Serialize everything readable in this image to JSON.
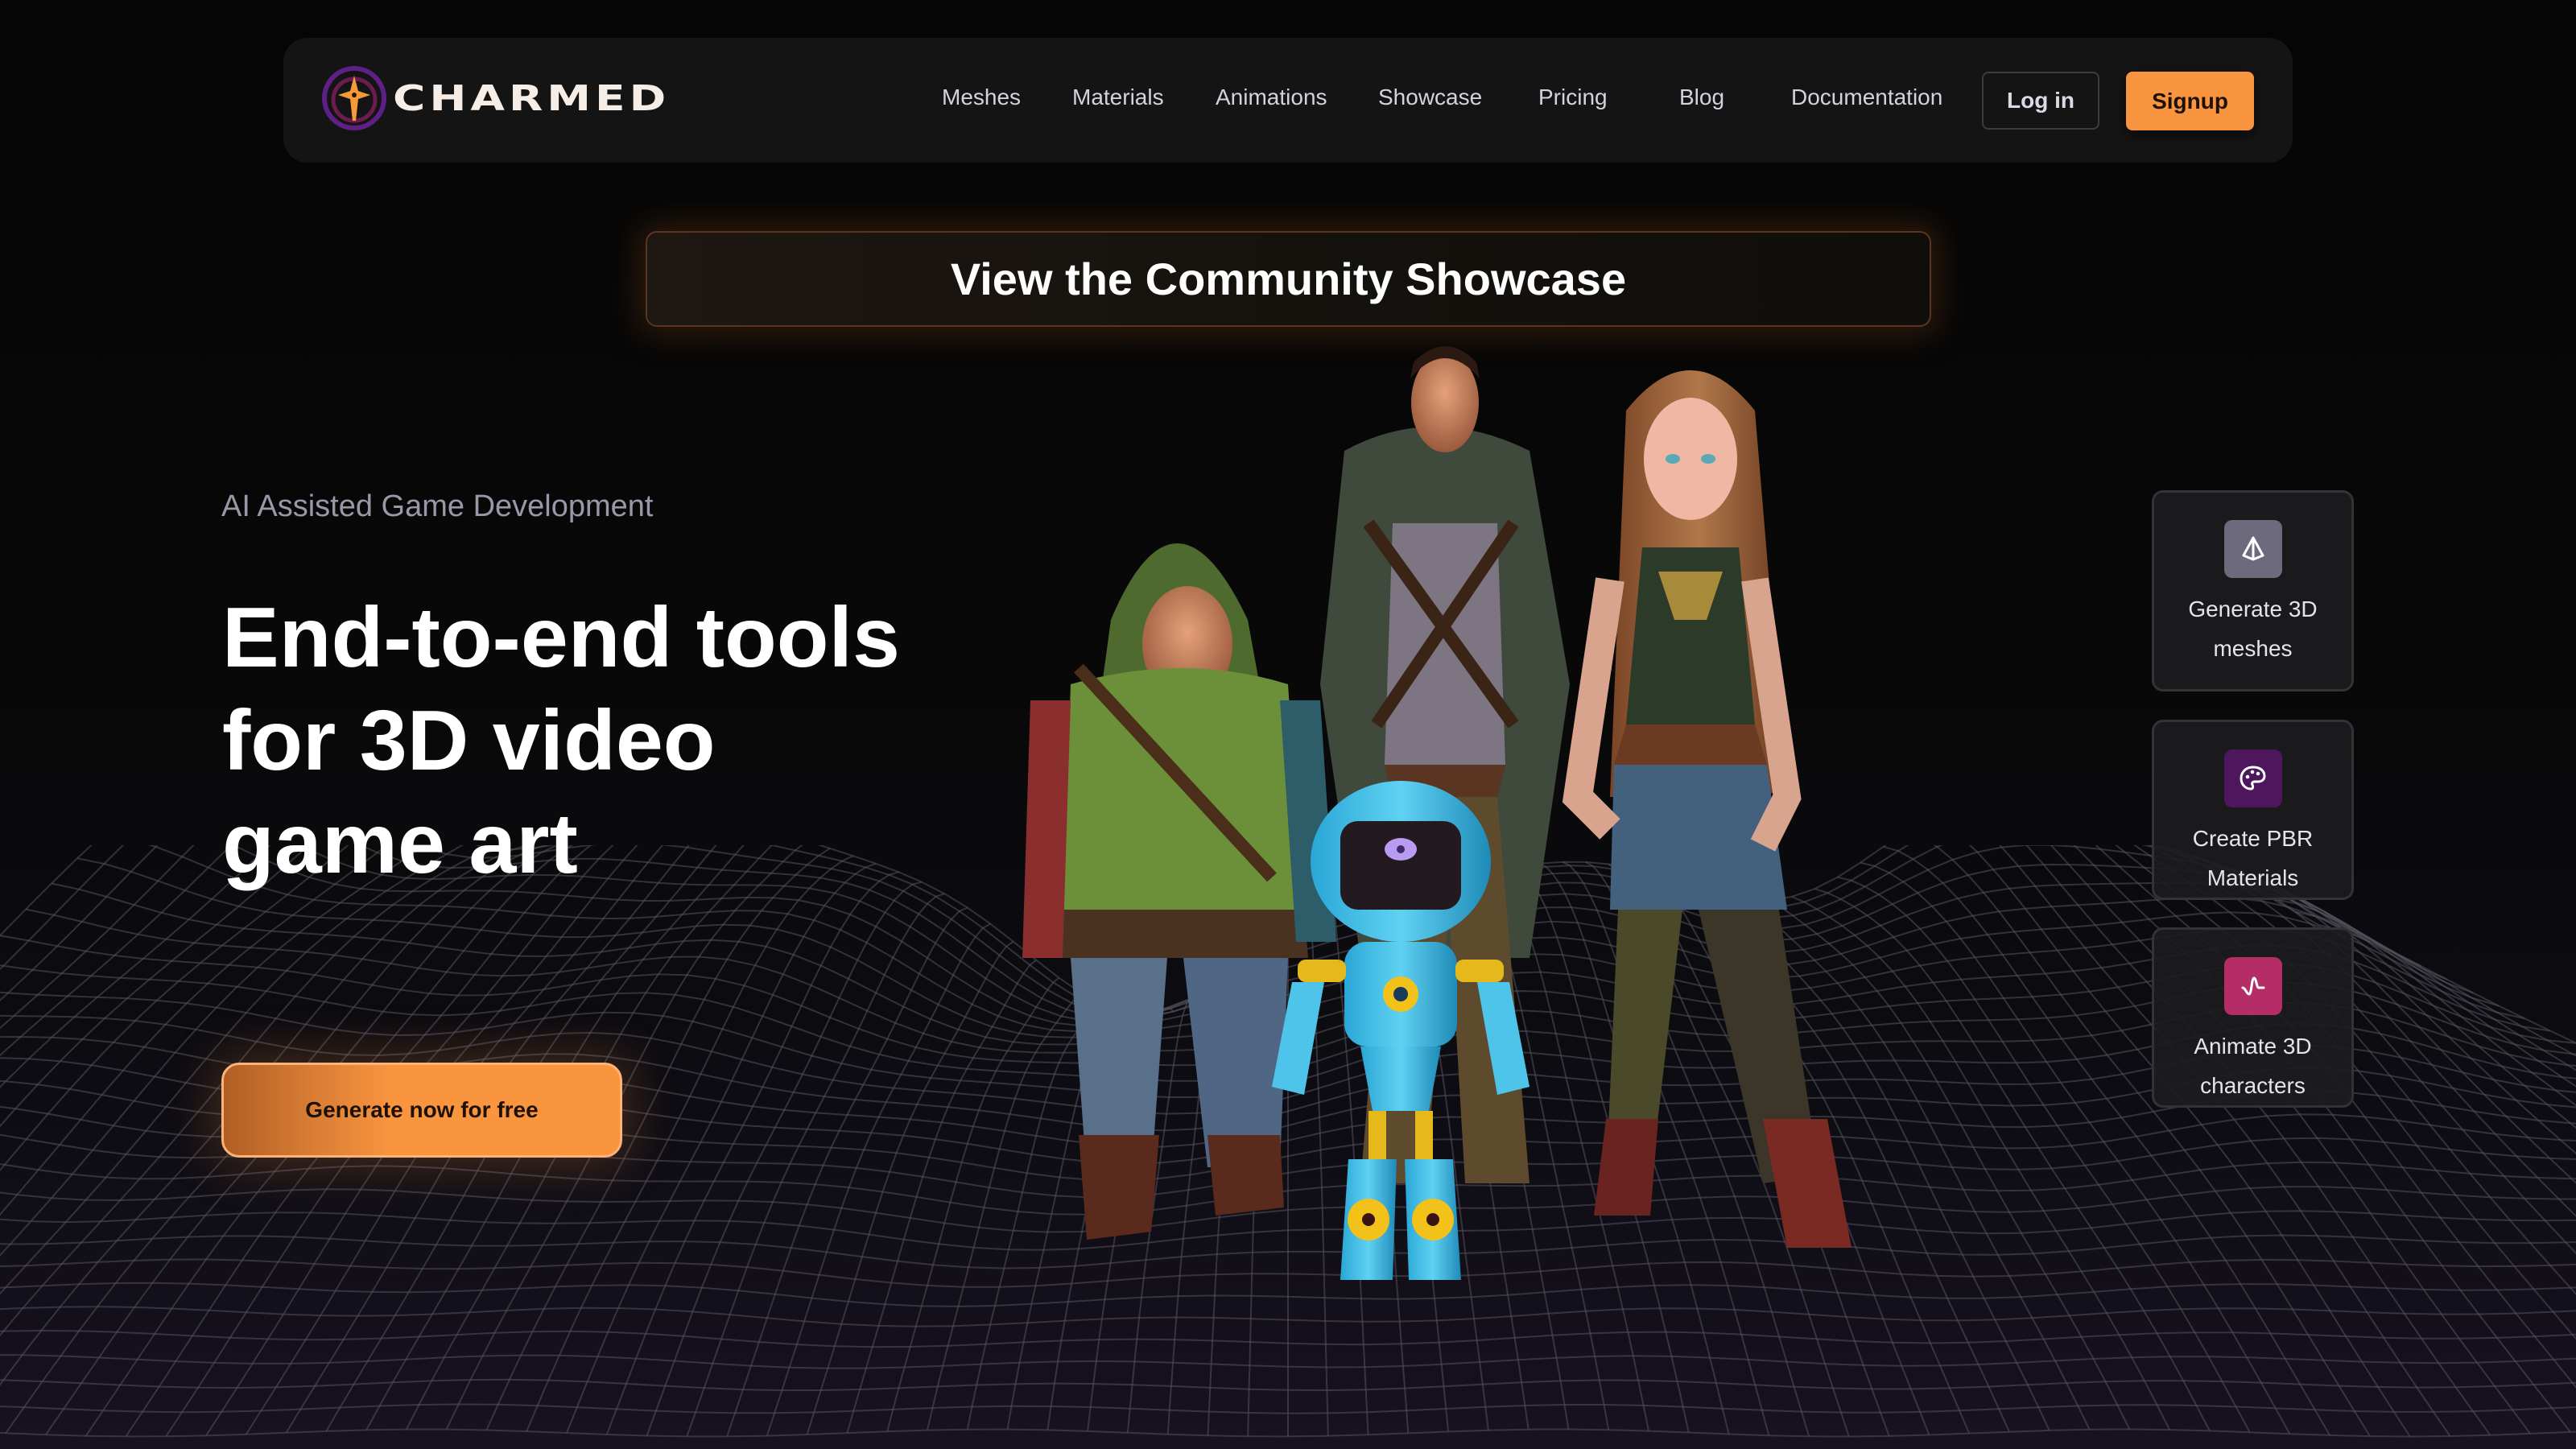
{
  "brand": {
    "name": "CHARMED",
    "accent": "#f9943f"
  },
  "nav": {
    "links": [
      "Meshes",
      "Materials",
      "Animations",
      "Showcase",
      "Pricing",
      "Blog",
      "Documentation"
    ],
    "login_label": "Log in",
    "signup_label": "Signup"
  },
  "banner": {
    "label": "View the Community Showcase"
  },
  "hero": {
    "eyebrow": "AI Assisted Game Development",
    "headline_lines": [
      "End-to-end tools",
      "for 3D video",
      "game art"
    ],
    "cta_label": "Generate now for free"
  },
  "features": [
    {
      "icon": "pyramid-icon",
      "label": "Generate 3D meshes",
      "color": "#6e6a7e"
    },
    {
      "icon": "palette-icon",
      "label": "Create PBR Materials",
      "color": "#4e165c"
    },
    {
      "icon": "waveform-icon",
      "label": "Animate 3D characters",
      "color": "#b52d67"
    }
  ],
  "illustration": {
    "description": "3D game characters: hooded ranger, tall cloaked man, long-haired adventurer woman, blue robot"
  }
}
